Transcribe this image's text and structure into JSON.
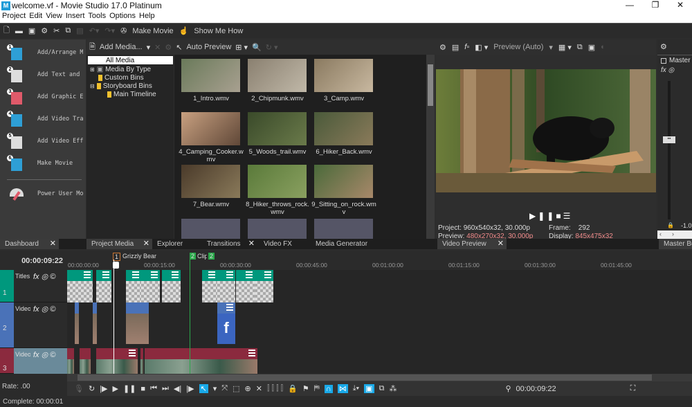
{
  "app": {
    "title": "welcome.vf - Movie Studio 17.0 Platinum",
    "logo": "M"
  },
  "menu": [
    "Project",
    "Edit",
    "View",
    "Insert",
    "Tools",
    "Options",
    "Help"
  ],
  "toolbar": {
    "make_movie": "Make Movie",
    "show_me_how": "Show Me How"
  },
  "dashboard": {
    "items": [
      {
        "num": "1",
        "label": "Add/Arrange Media",
        "icon": "add-media-icon"
      },
      {
        "num": "2",
        "label": "Add Text and Titles",
        "icon": "text-icon"
      },
      {
        "num": "3",
        "label": "Add Graphic Elements",
        "icon": "graphic-icon"
      },
      {
        "num": "4",
        "label": "Add Video Transitions",
        "icon": "transition-icon"
      },
      {
        "num": "5",
        "label": "Add Video Effects",
        "icon": "fx-icon"
      },
      {
        "num": "6",
        "label": "Make Movie",
        "icon": "make-movie-icon"
      }
    ],
    "power_user": "Power User Mode"
  },
  "media": {
    "add_media": "Add Media...",
    "auto_preview": "Auto Preview",
    "tree": [
      "All Media",
      "Media By Type",
      "Custom Bins",
      "Storyboard Bins",
      "Main Timeline"
    ],
    "files": [
      "1_Intro.wmv",
      "2_Chipmunk.wmv",
      "3_Camp.wmv",
      "4_Camping_Cooker.wmv",
      "5_Woods_trail.wmv",
      "6_Hiker_Back.wmv",
      "7_Bear.wmv",
      "8_Hiker_throws_rock.wmv",
      "9_Sitting_on_rock.wmv"
    ]
  },
  "preview": {
    "mode": "Preview (Auto)",
    "project_label": "Project:",
    "project_value": "960x540x32, 30.000p",
    "preview_label": "Preview:",
    "preview_value": "480x270x32, 30.000p",
    "frame_label": "Frame:",
    "frame_value": "292",
    "display_label": "Display:",
    "display_value": "845x475x32"
  },
  "master": {
    "label": "Master",
    "level": "-1.0",
    "tab": "Master Bus"
  },
  "tabs": [
    "Dashboard",
    "Project Media",
    "Explorer",
    "Transitions",
    "Video FX",
    "Media Generator",
    "Video Preview"
  ],
  "timeline": {
    "time": "00:00:09:22",
    "markers": [
      {
        "num": "1",
        "label": "Grizzly Bear"
      },
      {
        "num": "2",
        "label": "Clip"
      },
      {
        "num": "2",
        "label": ""
      }
    ],
    "ticks": [
      "00:00:00:00",
      "00:00:15:00",
      "00:00:30:00",
      "00:00:45:00",
      "00:01:00:00",
      "00:01:15:00",
      "00:01:30:00",
      "00:01:45:00"
    ],
    "tracks": [
      {
        "name": "Titles",
        "num": "1",
        "color": "#00987d"
      },
      {
        "name": "Video",
        "num": "2",
        "color": "#4a72b8"
      },
      {
        "name": "Video",
        "num": "3",
        "color": "#8b2a3e"
      }
    ],
    "cursor_time": "00:00:09:22"
  },
  "status": {
    "rate": "Rate: .00",
    "complete": "Complete: 00:00:01"
  },
  "colors": {
    "accent": "#19a9e8",
    "title_track": "#00987d",
    "video_track2": "#4a72b8",
    "video_track3": "#8b2a3e"
  }
}
